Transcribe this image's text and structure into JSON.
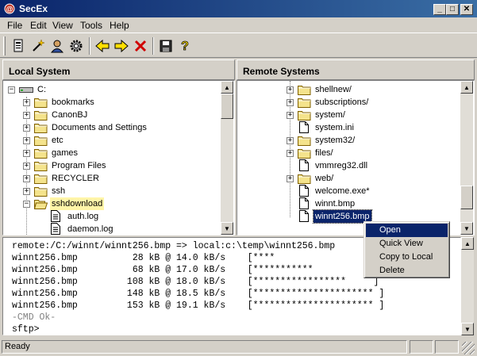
{
  "window": {
    "title": "SecEx"
  },
  "menu": [
    "File",
    "Edit",
    "View",
    "Tools",
    "Help"
  ],
  "toolbar": [
    "connection-icon",
    "wand-icon",
    "user-icon",
    "gear-icon",
    "back-arrow-icon",
    "forward-arrow-icon",
    "delete-icon",
    "save-icon",
    "help-icon"
  ],
  "local": {
    "header": "Local System",
    "root": "C:",
    "folders": [
      "bookmarks",
      "CanonBJ",
      "Documents and Settings",
      "etc",
      "games",
      "Program Files",
      "RECYCLER",
      "ssh"
    ],
    "open_folder": "sshdownload",
    "files": [
      "auth.log",
      "daemon.log"
    ]
  },
  "remote": {
    "header": "Remote Systems",
    "items": [
      "shellnew/",
      "subscriptions/",
      "system/",
      "system.ini",
      "system32/",
      "files/",
      "vmmreg32.dll",
      "web/",
      "welcome.exe*",
      "winnt.bmp",
      "winnt256.bmp"
    ]
  },
  "console": {
    "lines": [
      "remote:/C:/winnt/winnt256.bmp => local:c:\\temp\\winnt256.bmp",
      "winnt256.bmp          28 kB @ 14.0 kB/s    [****",
      "winnt256.bmp          68 kB @ 17.0 kB/s    [***********",
      "winnt256.bmp         108 kB @ 18.0 kB/s    [*****************     ]",
      "winnt256.bmp         148 kB @ 18.5 kB/s    [********************** ]",
      "winnt256.bmp         153 kB @ 19.1 kB/s    [********************** ]",
      "-CMD Ok-",
      "sftp>"
    ]
  },
  "context_menu": [
    "Open",
    "Quick View",
    "Copy to Local",
    "Delete"
  ],
  "status": {
    "text": "Ready"
  },
  "colors": {
    "title_bar": "#0a246a",
    "selection": "#0a246a",
    "folder": "#f4e38c",
    "face": "#d4d0c8"
  }
}
